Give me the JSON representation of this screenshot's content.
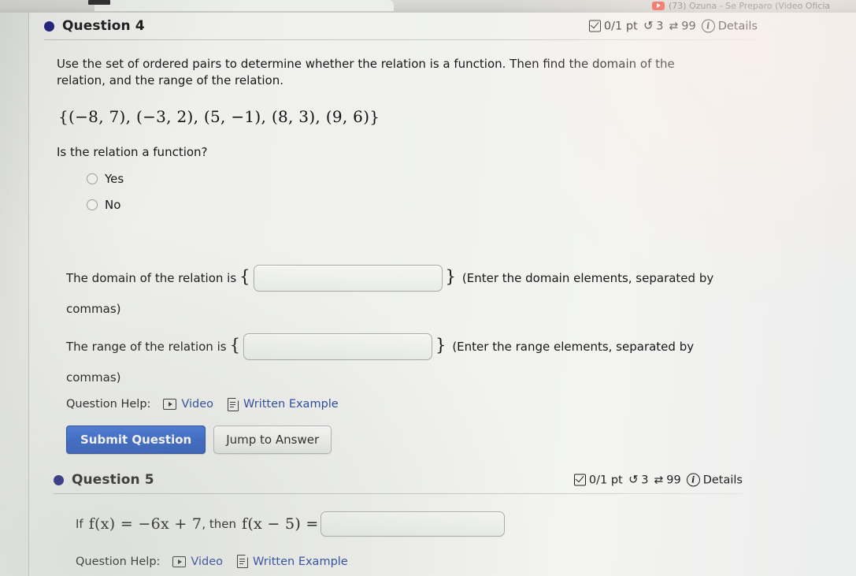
{
  "browser": {
    "tab_title": "(73) Ozuna - Se Preparo (Video Oficia"
  },
  "questions": [
    {
      "title": "Question 4",
      "meta": {
        "points": "0/1 pt",
        "attempts": "3",
        "retries": "99",
        "details": "Details"
      },
      "prompt": "Use the set of ordered pairs to determine whether the relation is a function. Then find the domain of the relation, and the range of the relation.",
      "math": "{(−8, 7), (−3, 2), (5, −1), (8, 3), (9, 6)}",
      "sub_question": "Is the relation a function?",
      "options": [
        "Yes",
        "No"
      ],
      "domain_row": {
        "prefix": "The domain of the relation is",
        "open_brace": "{",
        "close_brace": "}",
        "value": "",
        "hint": "(Enter the domain elements, separated by",
        "hint_cont": "commas)"
      },
      "range_row": {
        "prefix": "The range of the relation is",
        "open_brace": "{",
        "close_brace": "}",
        "value": "",
        "hint": "(Enter the range elements, separated by",
        "hint_cont": "commas)"
      },
      "help": {
        "label": "Question Help:",
        "video": "Video",
        "written": "Written Example"
      },
      "buttons": {
        "submit": "Submit Question",
        "jump": "Jump to Answer"
      }
    },
    {
      "title": "Question 5",
      "meta": {
        "points": "0/1 pt",
        "attempts": "3",
        "retries": "99",
        "details": "Details"
      },
      "math_prefix": "If",
      "math_fx": "f(x) = −6x + 7",
      "math_mid": ", then",
      "math_fx5": "f(x − 5) =",
      "value": "",
      "help": {
        "label": "Question Help:",
        "video": "Video",
        "written": "Written Example"
      }
    }
  ],
  "colors": {
    "dot": "#1b1c7a",
    "link": "#1f3f99",
    "primary_button": "#2a5cc4"
  }
}
